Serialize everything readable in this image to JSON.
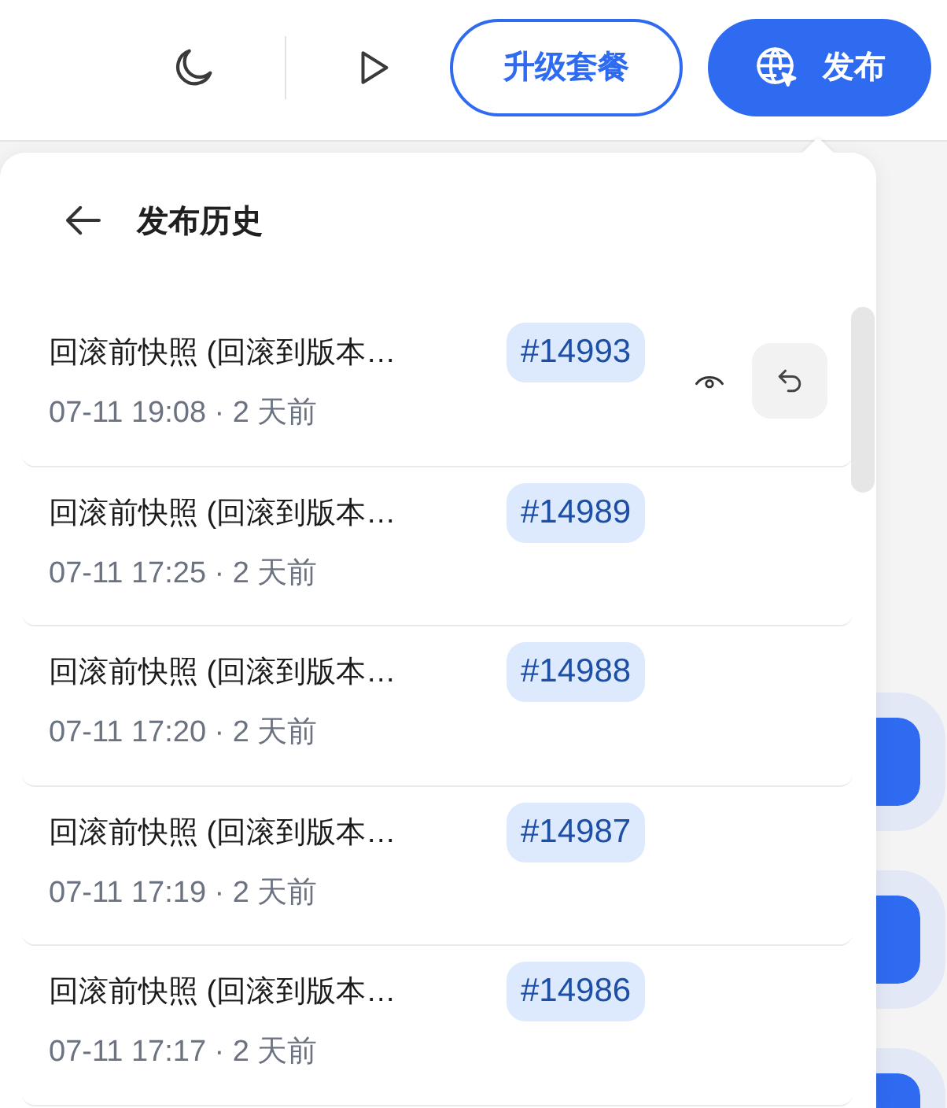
{
  "toolbar": {
    "upgrade_button": "升级套餐",
    "publish_button": "发布"
  },
  "side_buttons": [
    {
      "kind": "action"
    },
    {
      "kind": "action"
    },
    {
      "kind": "action"
    }
  ],
  "history_panel": {
    "title": "发布历史",
    "versions": [
      {
        "title": "回滚前快照 (回滚到版本…",
        "tag": "#14993",
        "time": "07-11 19:08 · 2 天前",
        "hovered": true
      },
      {
        "title": "回滚前快照 (回滚到版本…",
        "tag": "#14989",
        "time": "07-11 17:25 · 2 天前",
        "hovered": false
      },
      {
        "title": "回滚前快照 (回滚到版本…",
        "tag": "#14988",
        "time": "07-11 17:20 · 2 天前",
        "hovered": false
      },
      {
        "title": "回滚前快照 (回滚到版本…",
        "tag": "#14987",
        "time": "07-11 17:19 · 2 天前",
        "hovered": false
      },
      {
        "title": "回滚前快照 (回滚到版本…",
        "tag": "#14986",
        "time": "07-11 17:17 · 2 天前",
        "hovered": false
      }
    ]
  }
}
